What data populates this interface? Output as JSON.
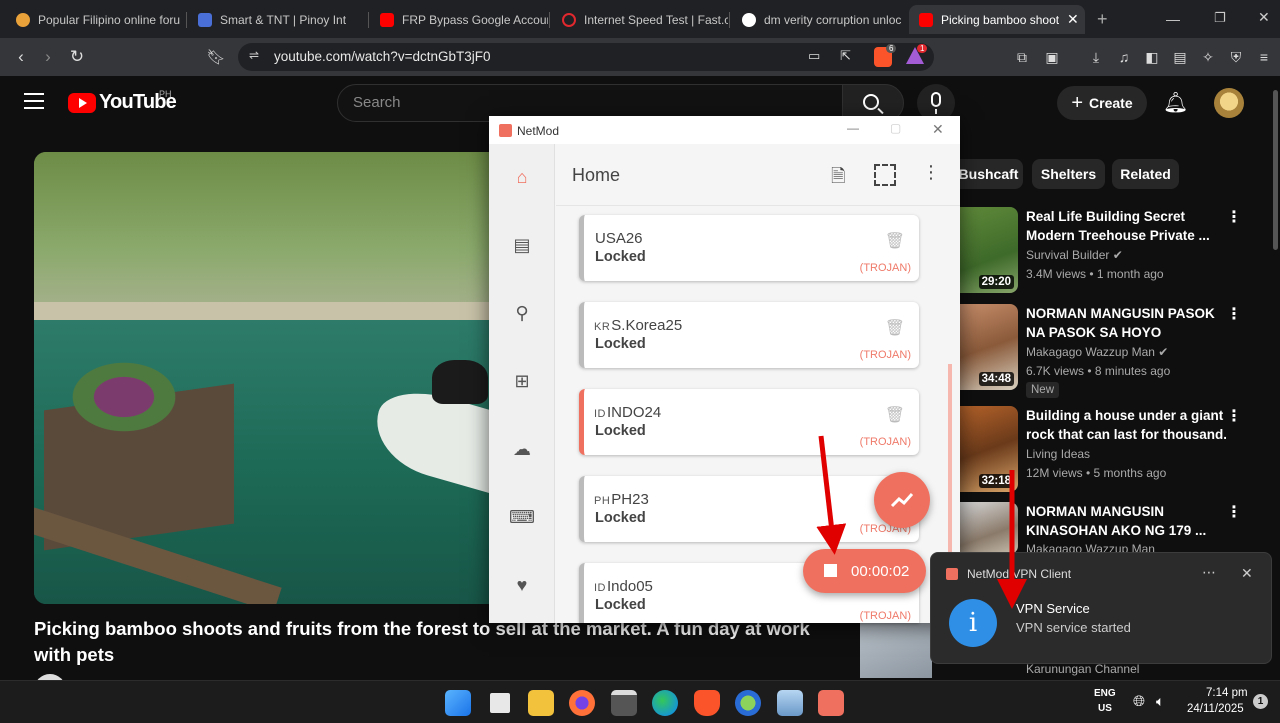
{
  "browser": {
    "tabs": [
      {
        "label": "Popular Filipino online foru",
        "color": "#e9a13a"
      },
      {
        "label": "Smart & TNT | Pinoy Int",
        "color": "#4a6fd6"
      },
      {
        "label": "FRP Bypass Google Accoun",
        "color": "#ff0000"
      },
      {
        "label": "Internet Speed Test | Fast.c",
        "color": "#e0282e"
      },
      {
        "label": "dm verity corruption unloc",
        "color": "#ffffff"
      },
      {
        "label": "Picking bamboo shoot",
        "color": "#ff0000",
        "active": true
      }
    ],
    "url": "youtube.com/watch?v=dctnGbT3jF0",
    "brave_badge": "6",
    "alert_badge": "1"
  },
  "youtube": {
    "logo": "YouTube",
    "region": "PH",
    "search_placeholder": "Search",
    "create_label": "Create",
    "video_title": "Picking bamboo shoots and fruits from the forest to sell at the market. A fun day at work with pets",
    "chips": [
      "Bushcaft",
      "Shelters",
      "Related"
    ],
    "recommended": [
      {
        "title1": "Real Life Building Secret",
        "title2": "Modern Treehouse Private ...",
        "channel": "Survival Builder",
        "meta": "3.4M views • 1 month ago",
        "duration": "29:20"
      },
      {
        "title1": "NORMAN MANGUSIN PASOK",
        "title2": "NA PASOK SA HOYO",
        "channel": "Makagago Wazzup Man",
        "meta": "6.7K views • 8 minutes ago",
        "duration": "34:48",
        "badge": "New"
      },
      {
        "title1": "Building a house under a giant",
        "title2": "rock that can last for thousand...",
        "channel": "Living Ideas",
        "meta": "12M views • 5 months ago",
        "duration": "32:18"
      },
      {
        "title1": "NORMAN MANGUSIN",
        "title2": "KINASOHAN AKO NG 179 ...",
        "channel": "Makagago Wazzup Man",
        "meta": "",
        "duration": ""
      }
    ],
    "partial_channel": "Karunungan Channel"
  },
  "netmod": {
    "app_title": "NetMod",
    "page_title": "Home",
    "servers": [
      {
        "prefix": "",
        "name": "USA26",
        "status": "Locked",
        "type": "(TROJAN)",
        "active": false
      },
      {
        "prefix": "KR",
        "name": "S.Korea25",
        "status": "Locked",
        "type": "(TROJAN)",
        "active": false
      },
      {
        "prefix": "ID",
        "name": "INDO24",
        "status": "Locked",
        "type": "(TROJAN)",
        "active": true
      },
      {
        "prefix": "PH",
        "name": "PH23",
        "status": "Locked",
        "type": "(TROJAN)",
        "active": false
      },
      {
        "prefix": "ID",
        "name": "Indo05",
        "status": "Locked",
        "type": "(TROJAN)",
        "active": false
      }
    ],
    "timer": "00:00:02",
    "accent": "#f0705f"
  },
  "notification": {
    "app": "NetMod VPN Client",
    "title": "VPN Service",
    "body": "VPN service started"
  },
  "taskbar": {
    "lang1": "ENG",
    "lang2": "US",
    "time": "7:14 pm",
    "date": "24/11/2025",
    "notif_count": "1"
  }
}
